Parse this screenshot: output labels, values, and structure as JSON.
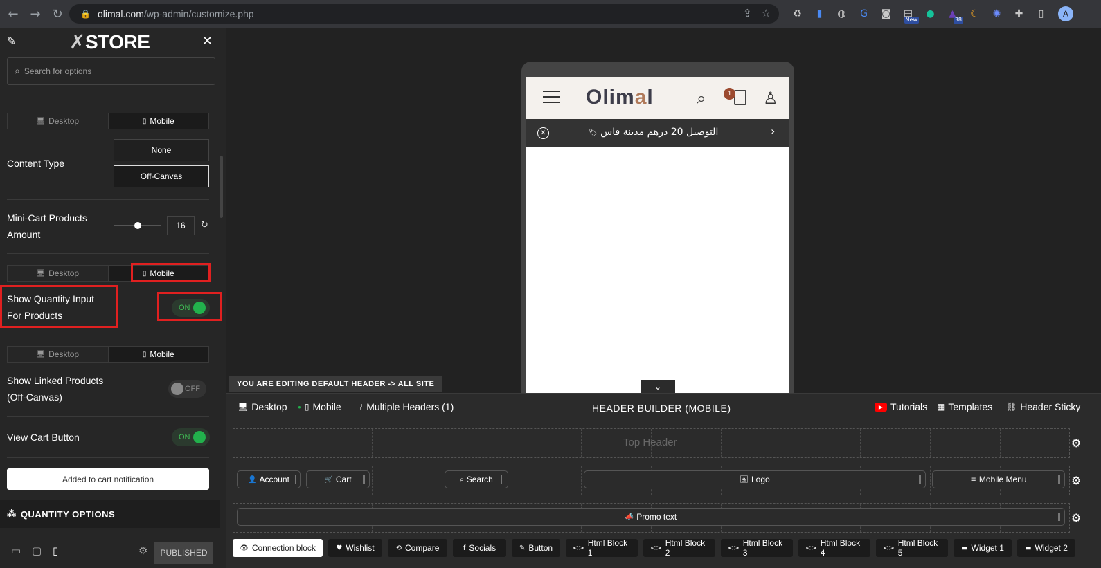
{
  "browser": {
    "url_host": "olimal.com",
    "url_path": "/wp-admin/customize.php",
    "ext_badge_new": "New",
    "ext_badge_count": "38",
    "avatar_initial": "A"
  },
  "panel": {
    "brand": "STORE",
    "search_placeholder": "Search for options",
    "device_desktop": "Desktop",
    "device_mobile": "Mobile",
    "content_type_label": "Content Type",
    "content_type_options": [
      "None",
      "Off-Canvas"
    ],
    "content_type_selected": "Off-Canvas",
    "mini_cart_label_1": "Mini-Cart Products",
    "mini_cart_label_2": "Amount",
    "mini_cart_amount": "16",
    "show_qty_label_1": "Show Quantity Input",
    "show_qty_label_2": "For Products",
    "show_qty_state": "ON",
    "show_linked_label_1": "Show Linked Products",
    "show_linked_label_2": "(Off-Canvas)",
    "show_linked_state": "OFF",
    "view_cart_label": "View Cart Button",
    "view_cart_state": "ON",
    "notification_button": "Added to cart notification",
    "section_title": "QUANTITY OPTIONS",
    "publish_label": "PUBLISHED"
  },
  "preview": {
    "site_logo_main": "Olim",
    "site_logo_accent": "a",
    "site_logo_end": "l",
    "cart_count": "1",
    "promo_text": "التوصيل 20 درهم مدينة فاس",
    "editing_label": "YOU ARE EDITING DEFAULT HEADER -> ALL SITE"
  },
  "builder": {
    "tab_desktop": "Desktop",
    "tab_mobile": "Mobile",
    "tab_multiple": "Multiple Headers (1)",
    "title": "HEADER BUILDER (MOBILE)",
    "tutorials": "Tutorials",
    "templates": "Templates",
    "header_sticky": "Header Sticky",
    "top_header": "Top Header",
    "row2_chips": [
      "Account",
      "Cart",
      "Search",
      "Logo",
      "Mobile Menu"
    ],
    "row3_chip": "Promo text",
    "palette": [
      "Connection block",
      "Wishlist",
      "Compare",
      "Socials",
      "Button",
      "Html Block 1",
      "Html Block 2",
      "Html Block 3",
      "Html Block 4",
      "Html Block 5",
      "Widget 1",
      "Widget 2"
    ]
  },
  "colors": {
    "accent_red": "#e02020",
    "toggle_green": "#22b14c",
    "promo_badge": "#9c4a2f"
  }
}
